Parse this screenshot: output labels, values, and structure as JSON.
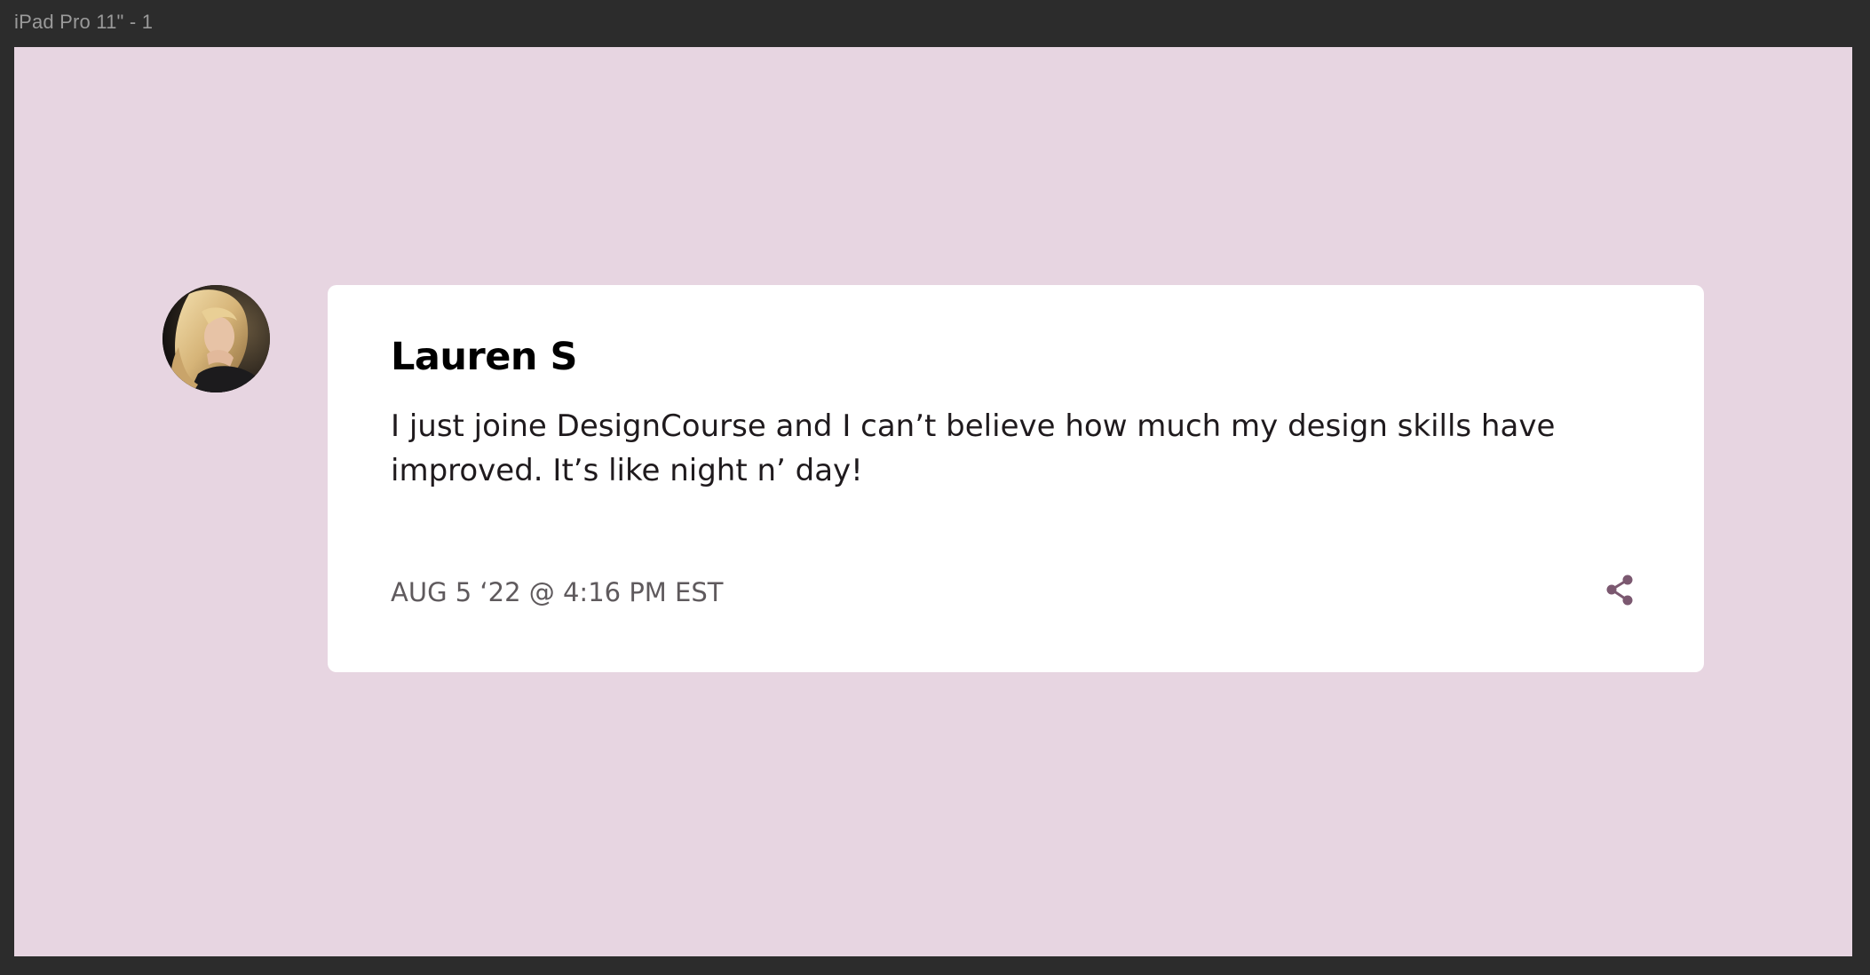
{
  "frame": {
    "label": "iPad Pro 11\" - 1"
  },
  "comment": {
    "author": "Lauren S",
    "message": "I just joine DesignCourse and I can’t believe how much my design skills have improved. It’s like night n’ day!",
    "timestamp": "AUG 5 ‘22 @ 4:16 PM EST",
    "share_icon": "share-icon"
  },
  "colors": {
    "canvas_bg": "#e7d5e1",
    "card_bg": "#ffffff",
    "accent": "#7b5870",
    "workspace_bg": "#2c2c2c"
  }
}
